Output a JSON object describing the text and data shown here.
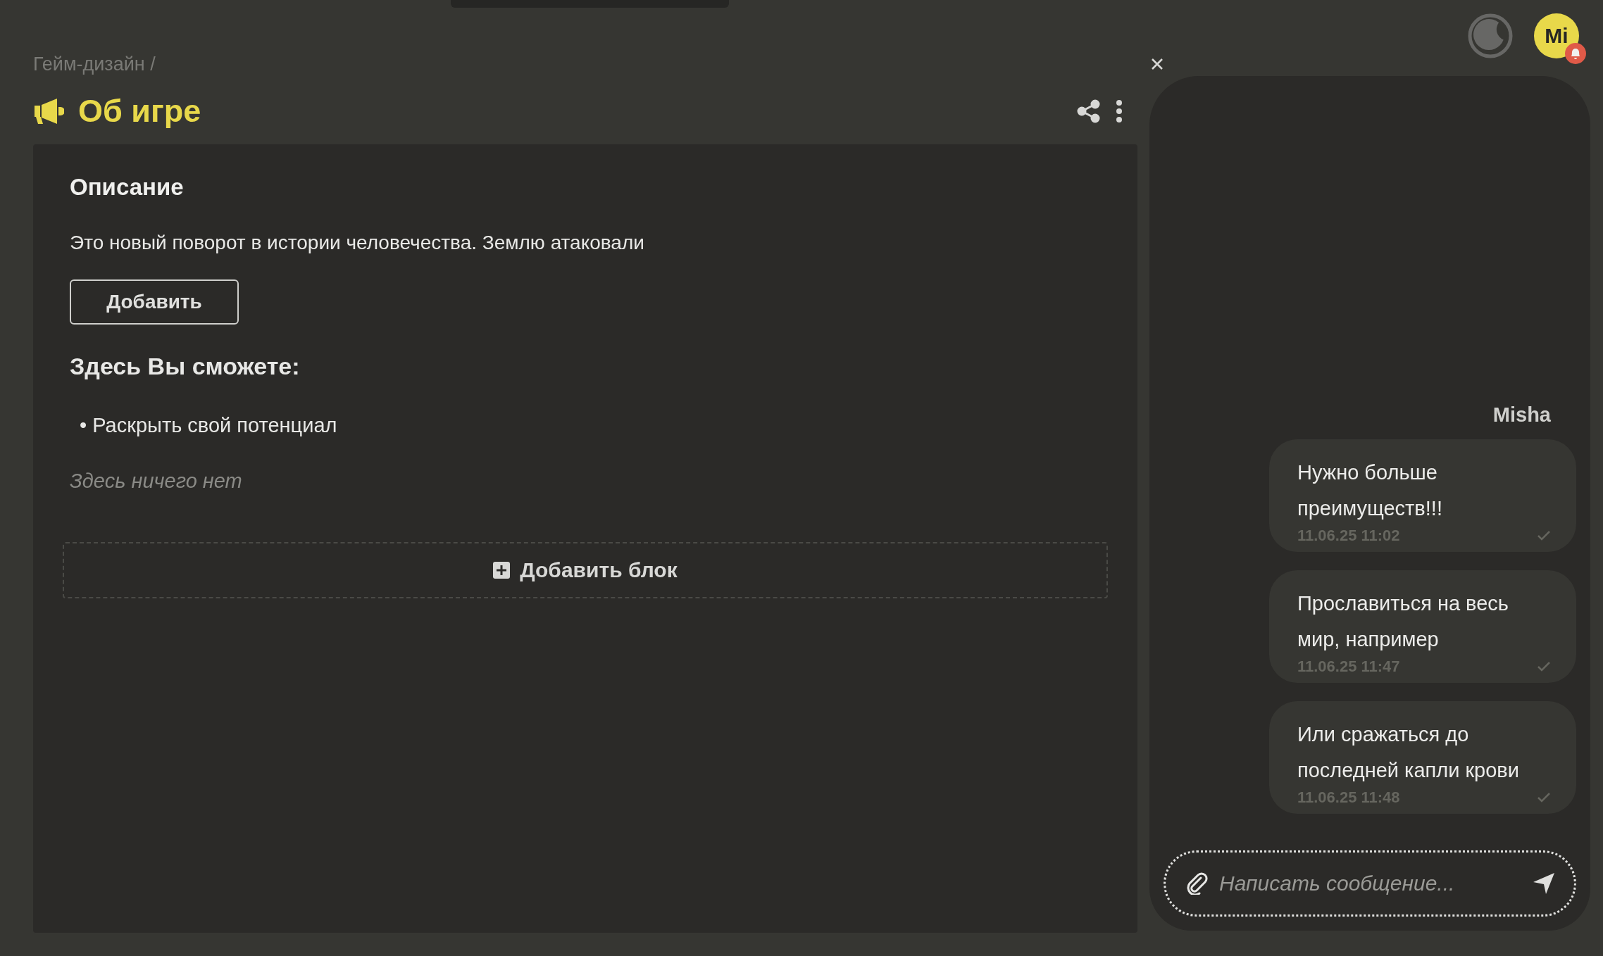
{
  "breadcrumb": "Гейм-дизайн /",
  "page_title": "Об игре",
  "content": {
    "heading": "Описание",
    "description": "Это новый поворот в истории человечества. Землю атаковали",
    "add_button": "Добавить",
    "subheading": "Здесь Вы сможете:",
    "bullets": [
      "• Раскрыть свой потенциал"
    ],
    "empty_hint": "Здесь ничего нет",
    "add_block_button": "Добавить блок"
  },
  "user_avatar": {
    "initials": "Mi",
    "notification": true
  },
  "chat": {
    "sender": "Misha",
    "messages": [
      {
        "text": "Нужно больше преимуществ!!!",
        "time": "11.06.25 11:02",
        "read": true
      },
      {
        "text": "Прославиться на весь мир, например",
        "time": "11.06.25 11:47",
        "read": true
      },
      {
        "text": "Или сражаться до последней капли крови",
        "time": "11.06.25 11:48",
        "read": true
      }
    ],
    "input": {
      "placeholder": "Написать сообщение..."
    }
  }
}
